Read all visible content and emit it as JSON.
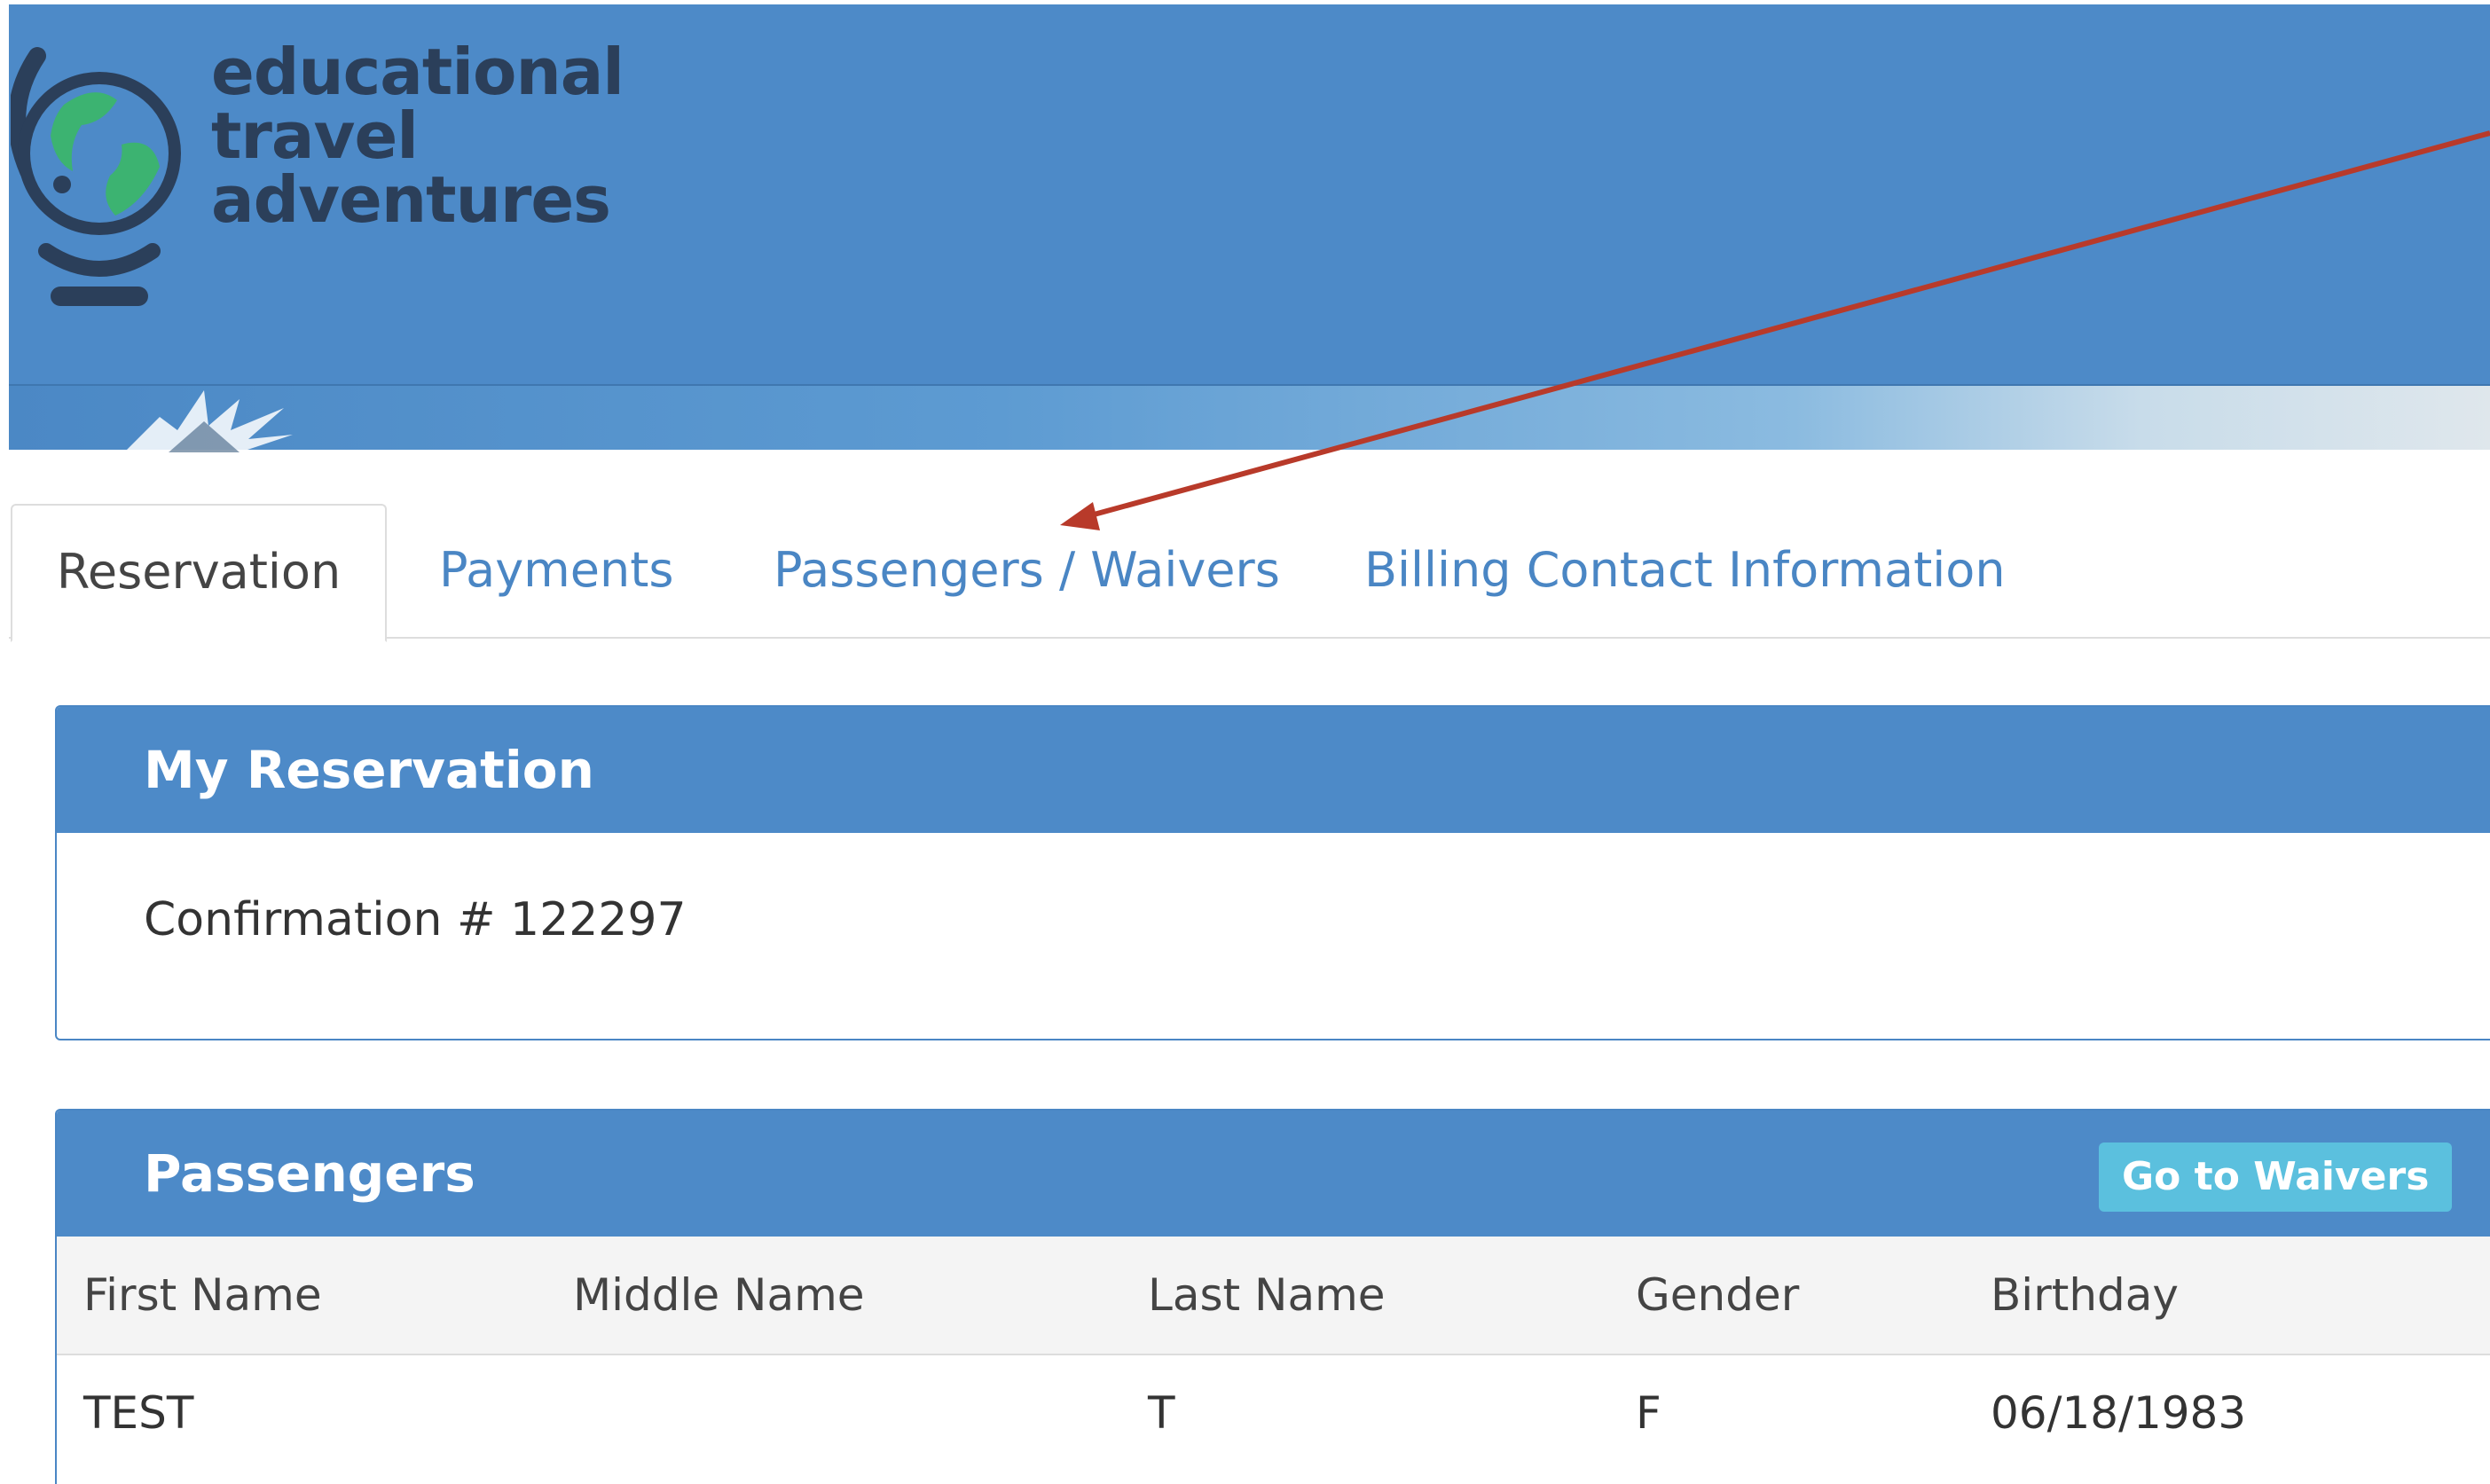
{
  "logo": {
    "line1": "educational",
    "line2": "travel",
    "line3": "adventures"
  },
  "tabs": [
    {
      "label": "Reservation",
      "active": true
    },
    {
      "label": "Payments",
      "active": false
    },
    {
      "label": "Passengers / Waivers",
      "active": false
    },
    {
      "label": "Billing Contact Information",
      "active": false
    }
  ],
  "reservation": {
    "title": "My Reservation",
    "confirmation": "Confirmation # 122297"
  },
  "passengers": {
    "title": "Passengers",
    "button_label": "Go to Waivers",
    "columns": [
      "First Name",
      "Middle Name",
      "Last Name",
      "Gender",
      "Birthday"
    ],
    "rows": [
      [
        "TEST",
        "",
        "T",
        "F",
        "06/18/1983"
      ]
    ]
  },
  "colors": {
    "brand_blue": "#4d8ac8",
    "link_blue": "#4a86c4",
    "button_cyan": "#5bc0de",
    "annotation_arrow": "#b83a2a"
  }
}
